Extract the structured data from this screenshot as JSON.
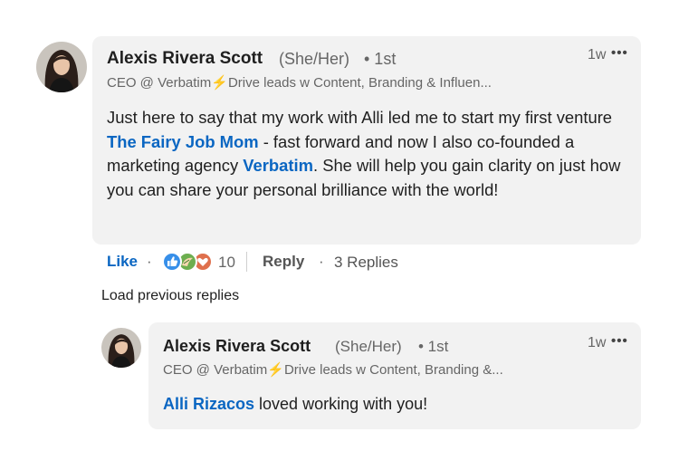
{
  "comment": {
    "author": "Alexis Rivera Scott",
    "pronouns": "(She/Her)",
    "degree": "• 1st",
    "headline_prefix": "CEO @ Verbatim",
    "headline_suffix": "Drive leads w Content, Branding & Influen...",
    "time": "1w",
    "menu": "•••",
    "text_1": "Just here to say that my work with Alli led me to start my first venture ",
    "mention_1": "The Fairy Job Mom",
    "text_2": " - fast forward and now I also co-founded a marketing agency ",
    "mention_2": "Verbatim",
    "text_3": ". She will help you gain clarity on just how you can share your personal brilliance with the world!"
  },
  "actions": {
    "like": "Like",
    "dot1": "·",
    "reaction_count": "10",
    "reply": "Reply",
    "dot2": "·",
    "replies": "3 Replies"
  },
  "load_previous": "Load previous replies",
  "reply_comment": {
    "author": "Alexis Rivera Scott",
    "pronouns": "(She/Her)",
    "degree": "• 1st",
    "headline_prefix": "CEO @ Verbatim",
    "headline_suffix": "Drive leads w Content, Branding &...",
    "time": "1w",
    "menu": "•••",
    "mention": "Alli Rizacos",
    "text": " loved working with you!"
  },
  "icons": {
    "bolt": "⚡",
    "reactions": [
      "like-reaction-icon",
      "support-reaction-icon",
      "love-reaction-icon"
    ]
  },
  "colors": {
    "link": "#0a66c2",
    "bubble": "#f2f2f2",
    "secondary": "#666666",
    "bolt": "#f5b417"
  }
}
